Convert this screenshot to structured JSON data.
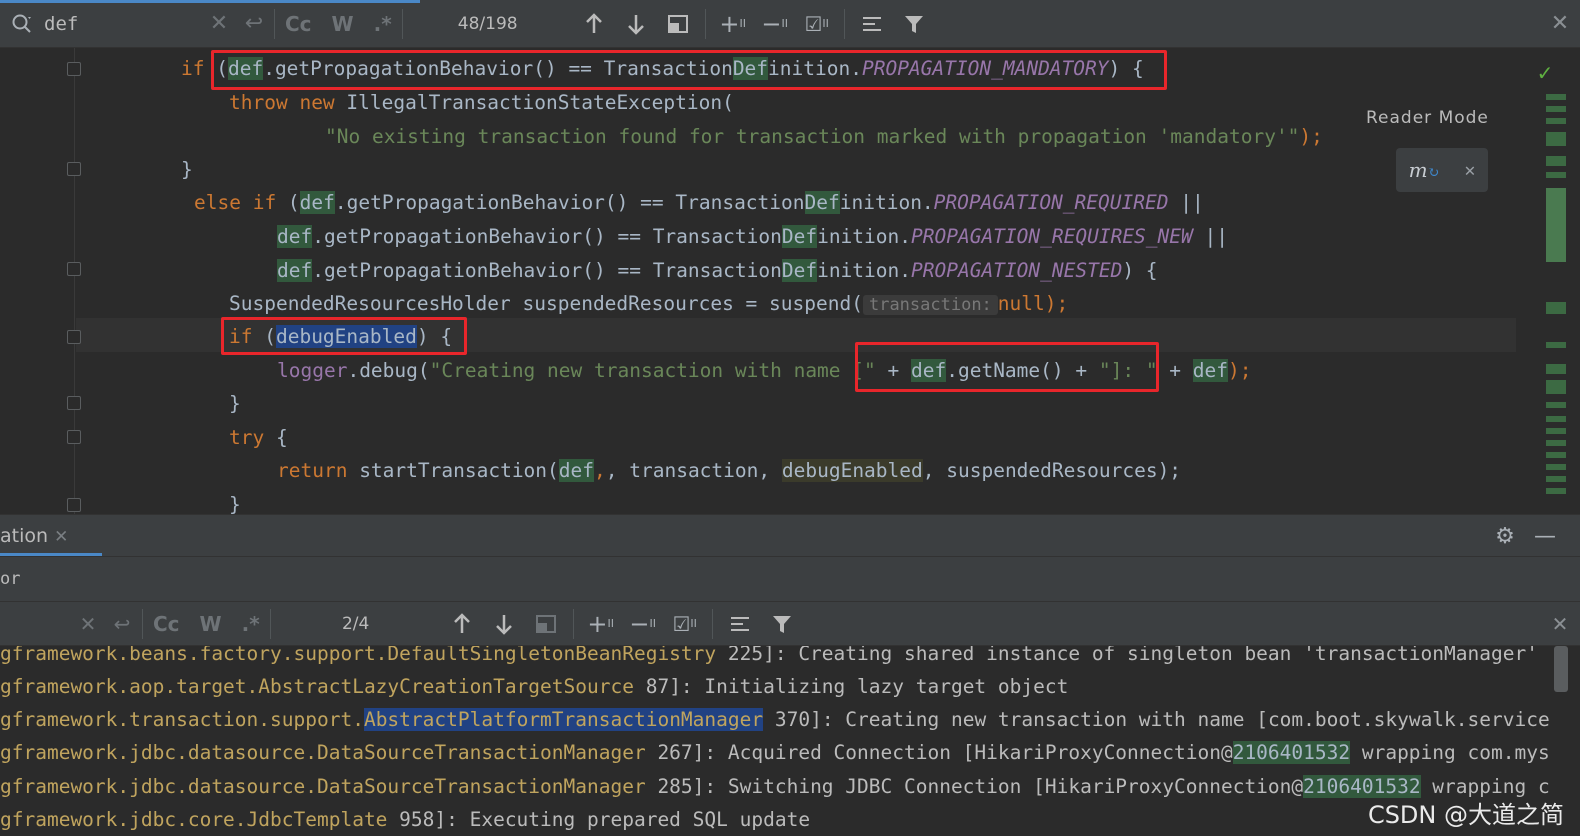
{
  "search_top": {
    "query": "def",
    "case_label": "Cc",
    "word_label": "W",
    "regex_label": ".*",
    "counter": "48/198"
  },
  "search_bottom": {
    "query": "",
    "case_label": "Cc",
    "word_label": "W",
    "regex_label": ".*",
    "counter": "2/4"
  },
  "editor": {
    "reader_mode": "Reader Mode",
    "inlay_hint": "transaction:",
    "lines": {
      "l1_kw": "if",
      "l1_def": "def",
      "l1_mid": ".getPropagationBehavior() == Transaction",
      "l1_def2": "Def",
      "l1_end": "inition.",
      "l1_const": "PROPAGATION_MANDATORY",
      "l1_tail": ") {",
      "l2_throw": "throw",
      "l2_new": "new",
      "l2_rest": " IllegalTransactionStateException(",
      "l3_str": "\"No existing transaction found for transaction marked with propagation 'mandatory'\"",
      "l3_tail": ");",
      "l4": "}",
      "l5_else": "else if",
      "l5_def": "def",
      "l5_mid": ".getPropagationBehavior() == Transaction",
      "l5_def2": "Def",
      "l5_end": "inition.",
      "l5_const": "PROPAGATION_REQUIRED",
      "l5_tail": " ||",
      "l6_def": "def",
      "l6_mid": ".getPropagationBehavior() == Transaction",
      "l6_def2": "Def",
      "l6_end": "inition.",
      "l6_const": "PROPAGATION_REQUIRES_NEW",
      "l6_tail": " ||",
      "l7_def": "def",
      "l7_mid": ".getPropagationBehavior() == Transaction",
      "l7_def2": "Def",
      "l7_end": "inition.",
      "l7_const": "PROPAGATION_NESTED",
      "l7_tail": ") {",
      "l8_a": "SuspendedResourcesHolder suspendedResources = suspend(",
      "l8_null": "null",
      "l8_tail": ");",
      "l9_kw": "if",
      "l9_sel": "debugEnabled",
      "l9_tail": ") {",
      "l10_logger": "logger",
      "l10_mid": ".debug(",
      "l10_str": "\"Creating new transaction with name [\"",
      "l10_plus": " + ",
      "l10_def": "def",
      "l10_getname": ".getName() + ",
      "l10_str2": "\"]: \"",
      "l10_plus2": " + ",
      "l10_def2": "def",
      "l10_tail": ");",
      "l11": "}",
      "l12_kw": "try",
      "l12_tail": " {",
      "l13_kw": "return",
      "l13_a": " startTransaction(",
      "l13_def": "def",
      "l13_comma": ", transaction, ",
      "l13_dbg": "debugEnabled",
      "l13_tail": ", suspendedResources);",
      "l14": "}"
    }
  },
  "panel": {
    "tab_label": "ation",
    "sub_text": "or"
  },
  "console": {
    "rows": [
      {
        "cls": "gframework.beans.factory.support.DefaultSingletonBeanRegistry",
        "rest": " 225]: Creating shared instance of singleton bean 'transactionManager'"
      },
      {
        "cls": "gframework.aop.target.AbstractLazyCreationTargetSource",
        "rest": " 87]: Initializing lazy target object"
      },
      {
        "cls_a": "gframework.transaction.support.",
        "cls_sel": "AbstractPlatformTransactionManager",
        "rest": " 370]: Creating new transaction with name [com.boot.skywalk.service"
      },
      {
        "cls": "gframework.jdbc.datasource.DataSourceTransactionManager",
        "rest_a": " 267]: Acquired Connection [HikariProxyConnection@",
        "hl": "2106401532",
        "rest_b": " wrapping com.mys"
      },
      {
        "cls": "gframework.jdbc.datasource.DataSourceTransactionManager",
        "rest_a": " 285]: Switching JDBC Connection [HikariProxyConnection@",
        "hl": "2106401532",
        "rest_b": " wrapping c"
      },
      {
        "cls": "gframework.jdbc.core.JdbcTemplate",
        "rest": " 958]: Executing prepared SQL update"
      }
    ]
  },
  "watermark": "CSDN @大道之简"
}
